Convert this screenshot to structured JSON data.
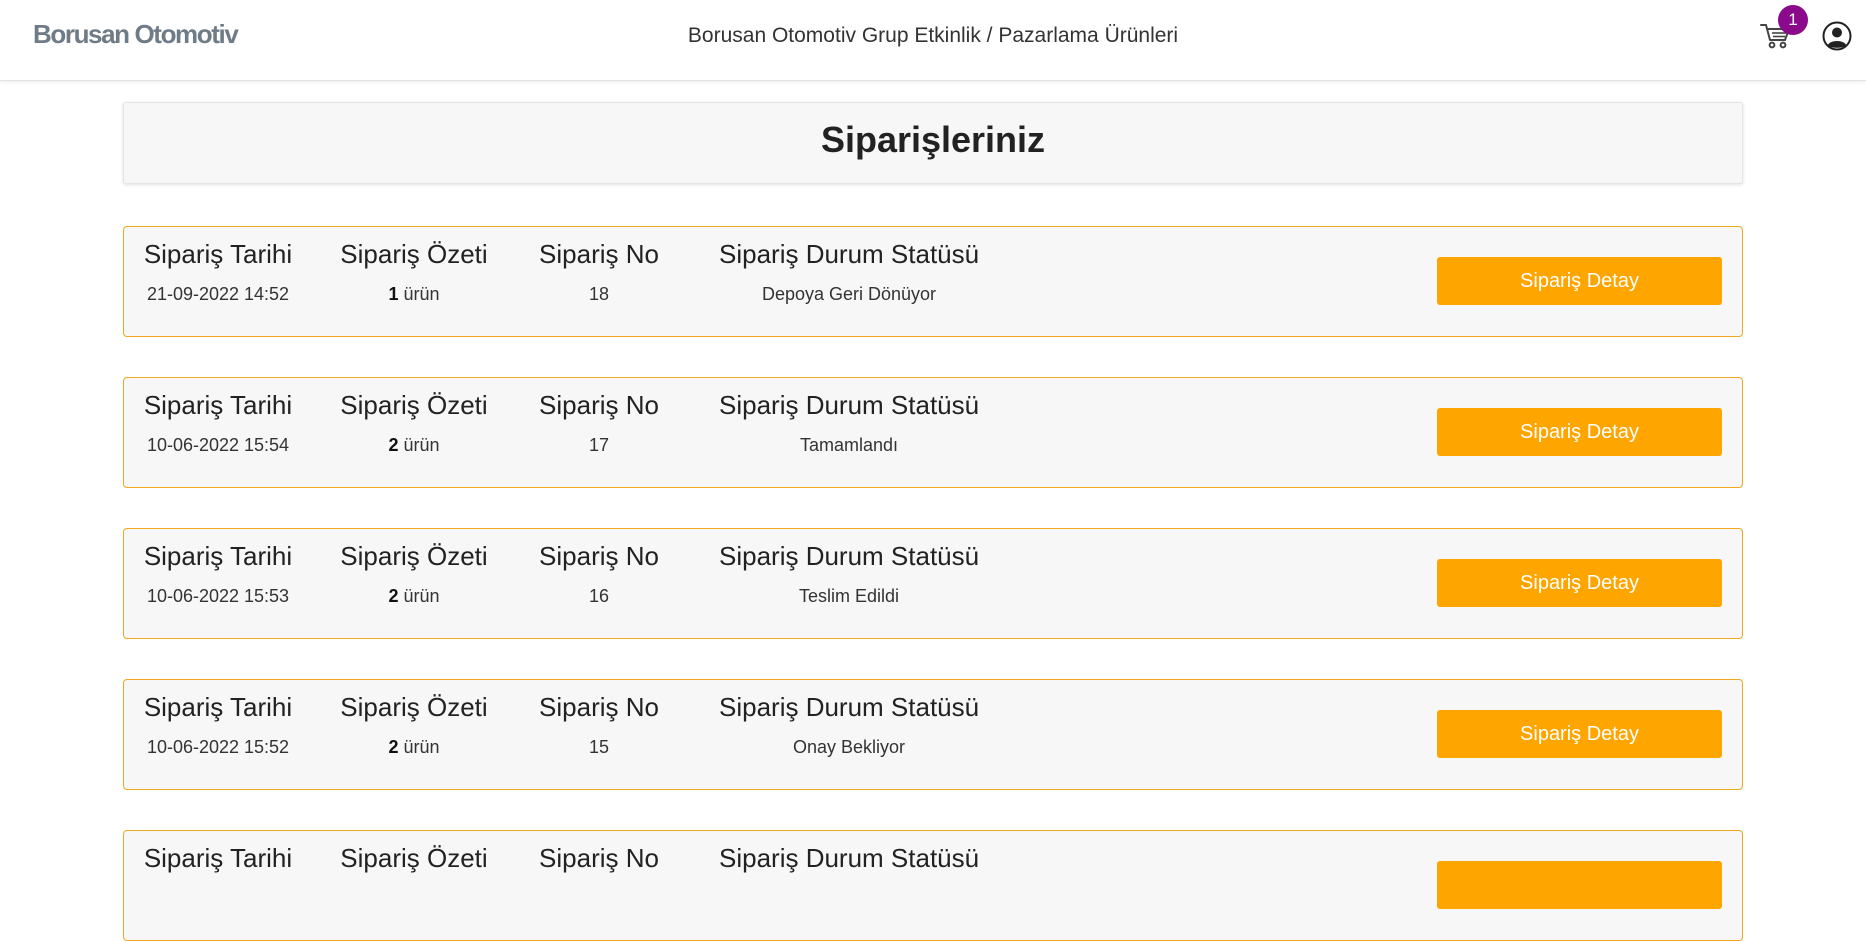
{
  "header": {
    "brand": "Borusan Otomotiv",
    "title": "Borusan Otomotiv Grup Etkinlik / Pazarlama Ürünleri",
    "cart_count": "1",
    "badge_color": "#8b0a8b"
  },
  "page": {
    "title": "Siparişleriniz"
  },
  "labels": {
    "date": "Sipariş Tarihi",
    "summary": "Sipariş Özeti",
    "order_no": "Sipariş No",
    "status": "Sipariş Durum Statüsü",
    "unit": "ürün",
    "detail_button": "Sipariş Detay"
  },
  "accent_color": "#ffa500",
  "orders": [
    {
      "date": "21-09-2022 14:52",
      "count": "1",
      "no": "18",
      "status": "Depoya Geri Dönüyor"
    },
    {
      "date": "10-06-2022 15:54",
      "count": "2",
      "no": "17",
      "status": "Tamamlandı"
    },
    {
      "date": "10-06-2022 15:53",
      "count": "2",
      "no": "16",
      "status": "Teslim Edildi"
    },
    {
      "date": "10-06-2022 15:52",
      "count": "2",
      "no": "15",
      "status": "Onay Bekliyor"
    },
    {
      "date": "",
      "count": "",
      "no": "",
      "status": ""
    }
  ]
}
